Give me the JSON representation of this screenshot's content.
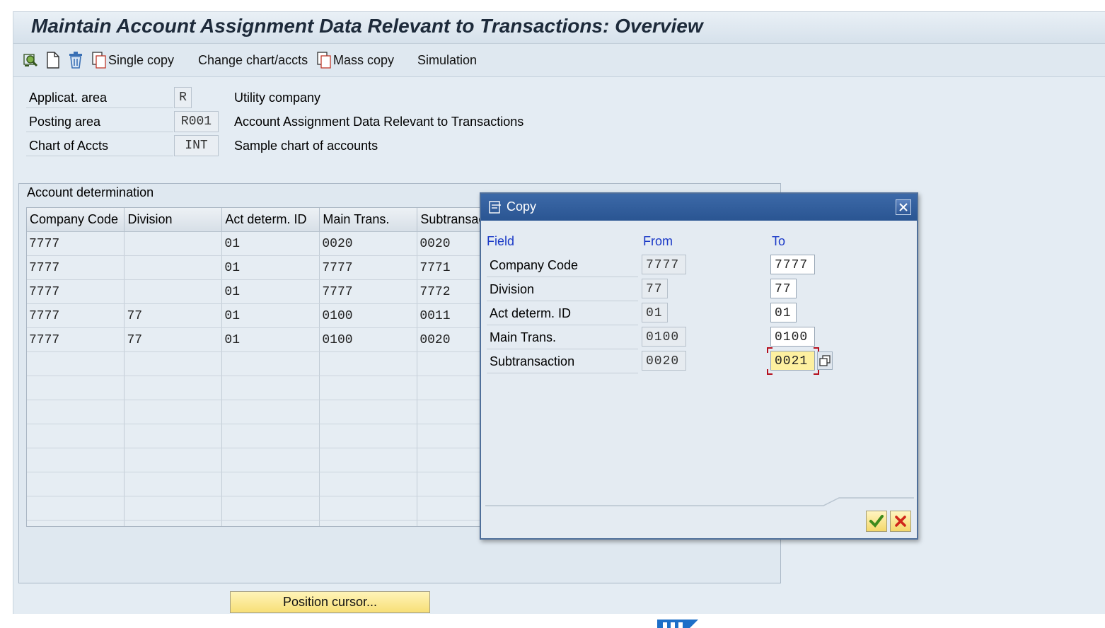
{
  "window": {
    "title": "Maintain Account Assignment Data Relevant to Transactions: Overview"
  },
  "toolbar": {
    "single_copy": "Single copy",
    "change_chart": "Change chart/accts",
    "mass_copy": "Mass copy",
    "simulation": "Simulation"
  },
  "header_fields": [
    {
      "label": "Applicat. area",
      "value": "R",
      "description": "Utility company"
    },
    {
      "label": "Posting area",
      "value": "R001",
      "description": "Account Assignment Data Relevant to Transactions"
    },
    {
      "label": "Chart of Accts",
      "value": "INT",
      "description": "Sample chart of accounts"
    }
  ],
  "account_determination": {
    "title": "Account determination",
    "columns": [
      "Company Code",
      "Division",
      "Act determ. ID",
      "Main Trans.",
      "Subtransac"
    ],
    "rows": [
      [
        "7777",
        "",
        "01",
        "0020",
        "0020"
      ],
      [
        "7777",
        "",
        "01",
        "7777",
        "7771"
      ],
      [
        "7777",
        "",
        "01",
        "7777",
        "7772"
      ],
      [
        "7777",
        "77",
        "01",
        "0100",
        "0011"
      ],
      [
        "7777",
        "77",
        "01",
        "0100",
        "0020"
      ]
    ]
  },
  "position_button": "Position cursor...",
  "copy_dialog": {
    "title": "Copy",
    "col_field": "Field",
    "col_from": "From",
    "col_to": "To",
    "rows": [
      {
        "field": "Company Code",
        "from": "7777",
        "to": "7777"
      },
      {
        "field": "Division",
        "from": "77",
        "to": "77"
      },
      {
        "field": "Act determ. ID",
        "from": "01",
        "to": "01"
      },
      {
        "field": "Main Trans.",
        "from": "0100",
        "to": "0100"
      },
      {
        "field": "Subtransaction",
        "from": "0020",
        "to": "0021"
      }
    ]
  },
  "colors": {
    "title_bar_dialog": "#2a5592",
    "focus_field": "#fdf0a0",
    "dialog_heading": "#1a39c7",
    "button_yellow": "#f7df77"
  }
}
